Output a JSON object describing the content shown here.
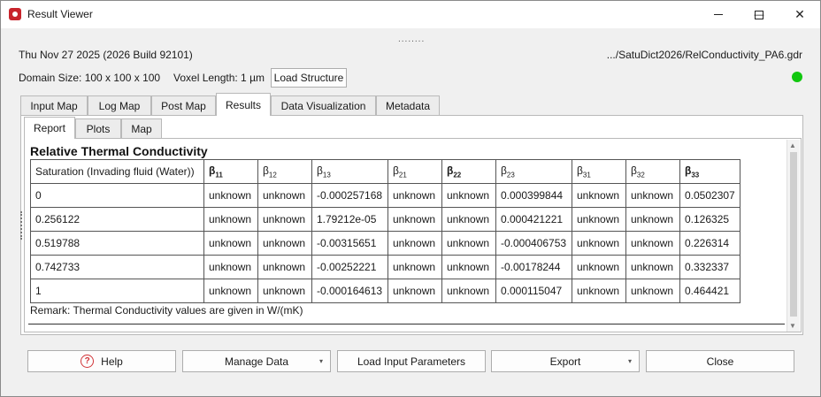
{
  "window": {
    "title": "Result Viewer",
    "minimize_glyph": "—",
    "maximize_glyph": "☐",
    "close_glyph": "✕"
  },
  "header": {
    "date_build": "Thu Nov 27 2025 (2026 Build 92101)",
    "file_path": ".../SatuDict2026/RelConductivity_PA6.gdr",
    "domain_size": "Domain Size: 100 x 100 x 100",
    "voxel_length": "Voxel Length: 1 µm",
    "load_structure_label": "Load Structure",
    "status_color": "#11c70f"
  },
  "tabs": [
    {
      "label": "Input Map",
      "active": false
    },
    {
      "label": "Log Map",
      "active": false
    },
    {
      "label": "Post Map",
      "active": false
    },
    {
      "label": "Results",
      "active": true
    },
    {
      "label": "Data Visualization",
      "active": false
    },
    {
      "label": "Metadata",
      "active": false
    }
  ],
  "subtabs": [
    {
      "label": "Report",
      "active": true
    },
    {
      "label": "Plots",
      "active": false
    },
    {
      "label": "Map",
      "active": false
    }
  ],
  "report": {
    "title": "Relative Thermal Conductivity",
    "columns": [
      {
        "base": "Saturation (Invading fluid (Water))",
        "sub": "",
        "bold": false
      },
      {
        "base": "β",
        "sub": "11",
        "bold": true
      },
      {
        "base": "β",
        "sub": "12",
        "bold": false
      },
      {
        "base": "β",
        "sub": "13",
        "bold": false
      },
      {
        "base": "β",
        "sub": "21",
        "bold": false
      },
      {
        "base": "β",
        "sub": "22",
        "bold": true
      },
      {
        "base": "β",
        "sub": "23",
        "bold": false
      },
      {
        "base": "β",
        "sub": "31",
        "bold": false
      },
      {
        "base": "β",
        "sub": "32",
        "bold": false
      },
      {
        "base": "β",
        "sub": "33",
        "bold": true
      }
    ],
    "rows": [
      [
        "0",
        "unknown",
        "unknown",
        "-0.000257168",
        "unknown",
        "unknown",
        "0.000399844",
        "unknown",
        "unknown",
        "0.0502307"
      ],
      [
        "0.256122",
        "unknown",
        "unknown",
        "1.79212e-05",
        "unknown",
        "unknown",
        "0.000421221",
        "unknown",
        "unknown",
        "0.126325"
      ],
      [
        "0.519788",
        "unknown",
        "unknown",
        "-0.00315651",
        "unknown",
        "unknown",
        "-0.000406753",
        "unknown",
        "unknown",
        "0.226314"
      ],
      [
        "0.742733",
        "unknown",
        "unknown",
        "-0.00252221",
        "unknown",
        "unknown",
        "-0.00178244",
        "unknown",
        "unknown",
        "0.332337"
      ],
      [
        "1",
        "unknown",
        "unknown",
        "-0.000164613",
        "unknown",
        "unknown",
        "0.000115047",
        "unknown",
        "unknown",
        "0.464421"
      ]
    ],
    "remark": "Remark: Thermal Conductivity values are given in W/(mK)"
  },
  "footer": {
    "help_label": "Help",
    "manage_data_label": "Manage Data",
    "load_input_label": "Load Input Parameters",
    "export_label": "Export",
    "close_label": "Close",
    "dropdown_glyph": "▾",
    "help_glyph": "?"
  }
}
